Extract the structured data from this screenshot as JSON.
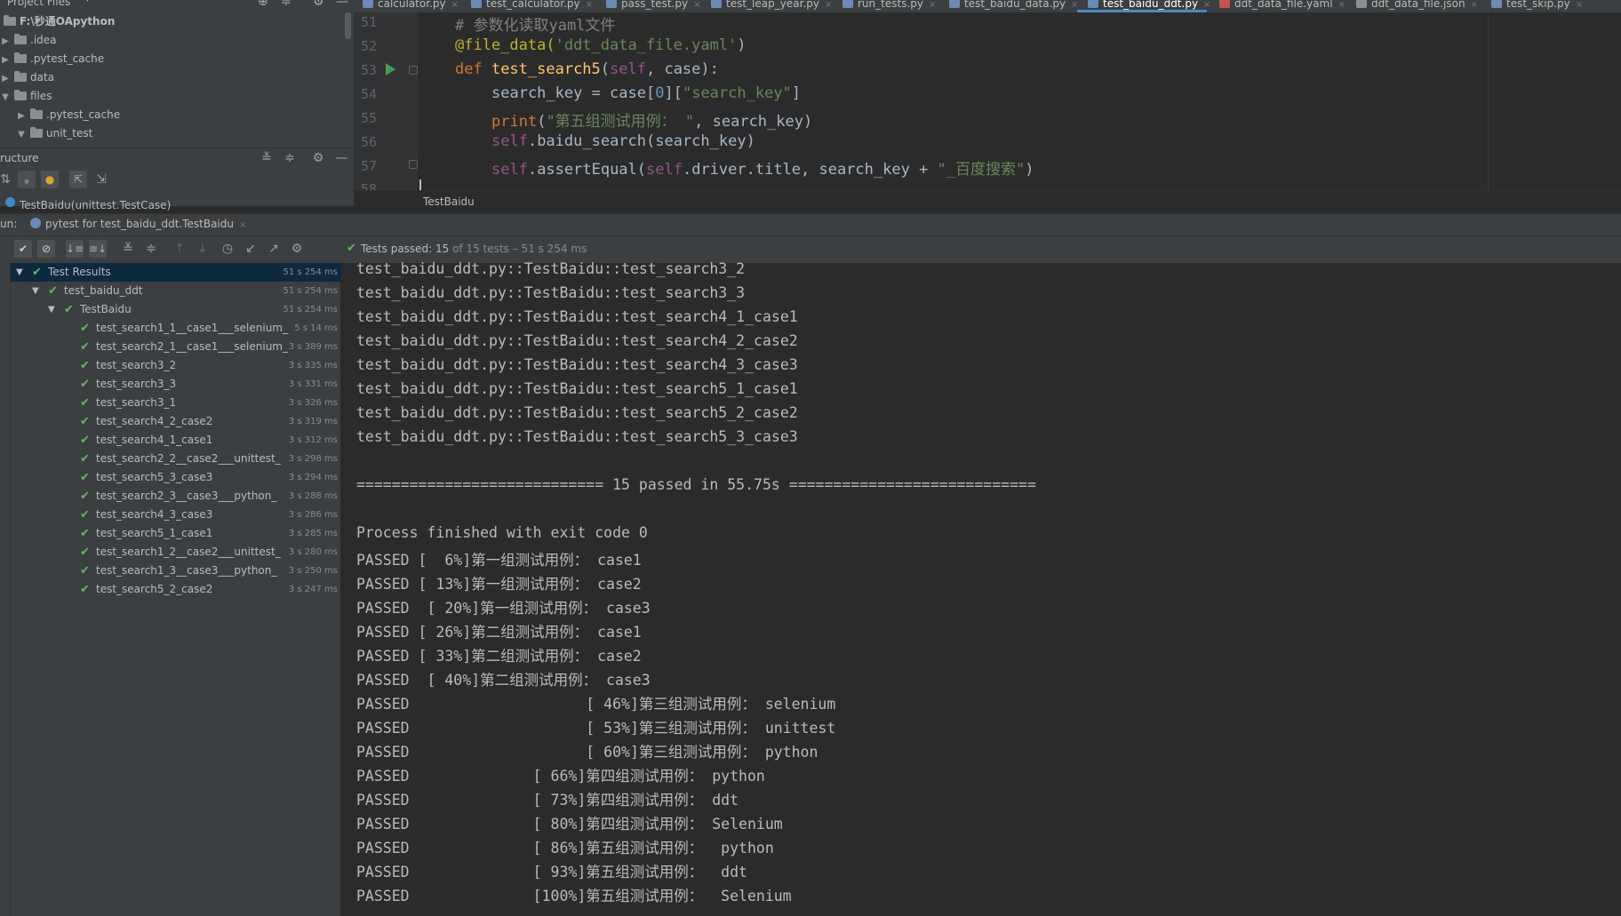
{
  "project": {
    "header": "Project Files",
    "root": "F:\\秒通OApython",
    "items": [
      ".idea",
      ".pytest_cache",
      "data",
      "files",
      ".pytest_cache",
      "unit_test"
    ]
  },
  "structure": {
    "title": "ructure",
    "item": "TestBaidu(unittest.TestCase)"
  },
  "editor": {
    "tabs": [
      "calculator.py",
      "test_calculator.py",
      "pass_test.py",
      "test_leap_year.py",
      "run_tests.py",
      "test_baidu_data.py",
      "test_baidu_ddt.py",
      "ddt_data_file.yaml",
      "ddt_data_file.json",
      "test_skip.py"
    ],
    "active_tab": "test_baidu_ddt.py",
    "line_numbers": [
      "51",
      "52",
      "53",
      "54",
      "55",
      "56",
      "57",
      "58"
    ],
    "breadcrumb": "TestBaidu"
  },
  "run": {
    "label": "un:",
    "tab": "pytest for test_baidu_ddt.TestBaidu",
    "status_passed": "Tests passed: 15",
    "status_of": "of 15 tests – 51 s 254 ms"
  },
  "tests": {
    "root": {
      "name": "Test Results",
      "time": "51 s 254 ms"
    },
    "module": {
      "name": "test_baidu_ddt",
      "time": "51 s 254 ms"
    },
    "class": {
      "name": "TestBaidu",
      "time": "51 s 254 ms"
    },
    "items": [
      {
        "name": "test_search1_1__case1___selenium_",
        "time": "5 s 14 ms"
      },
      {
        "name": "test_search2_1__case1___selenium_",
        "time": "3 s 389 ms"
      },
      {
        "name": "test_search3_2",
        "time": "3 s 335 ms"
      },
      {
        "name": "test_search3_3",
        "time": "3 s 331 ms"
      },
      {
        "name": "test_search3_1",
        "time": "3 s 326 ms"
      },
      {
        "name": "test_search4_2_case2",
        "time": "3 s 319 ms"
      },
      {
        "name": "test_search4_1_case1",
        "time": "3 s 312 ms"
      },
      {
        "name": "test_search2_2__case2___unittest_",
        "time": "3 s 298 ms"
      },
      {
        "name": "test_search5_3_case3",
        "time": "3 s 294 ms"
      },
      {
        "name": "test_search2_3__case3___python_",
        "time": "3 s 288 ms"
      },
      {
        "name": "test_search4_3_case3",
        "time": "3 s 286 ms"
      },
      {
        "name": "test_search5_1_case1",
        "time": "3 s 285 ms"
      },
      {
        "name": "test_search1_2__case2___unittest_",
        "time": "3 s 280 ms"
      },
      {
        "name": "test_search1_3__case3___python_",
        "time": "3 s 250 ms"
      },
      {
        "name": "test_search5_2_case2",
        "time": "3 s 247 ms"
      }
    ]
  },
  "console": {
    "lines": [
      "test_baidu_ddt.py::TestBaidu::test_search3_2",
      "test_baidu_ddt.py::TestBaidu::test_search3_3",
      "test_baidu_ddt.py::TestBaidu::test_search4_1_case1",
      "test_baidu_ddt.py::TestBaidu::test_search4_2_case2",
      "test_baidu_ddt.py::TestBaidu::test_search4_3_case3",
      "test_baidu_ddt.py::TestBaidu::test_search5_1_case1",
      "test_baidu_ddt.py::TestBaidu::test_search5_2_case2",
      "test_baidu_ddt.py::TestBaidu::test_search5_3_case3",
      "",
      "============================ 15 passed in 55.75s ============================",
      "",
      "Process finished with exit code 0",
      "PASSED [  6%]第一组测试用例： case1",
      "PASSED [ 13%]第一组测试用例： case2",
      "PASSED  [ 20%]第一组测试用例： case3",
      "PASSED [ 26%]第二组测试用例： case1",
      "PASSED [ 33%]第二组测试用例： case2",
      "PASSED  [ 40%]第二组测试用例： case3",
      "PASSED                    [ 46%]第三组测试用例： selenium",
      "PASSED                    [ 53%]第三组测试用例： unittest",
      "PASSED                    [ 60%]第三组测试用例： python",
      "PASSED              [ 66%]第四组测试用例： python",
      "PASSED              [ 73%]第四组测试用例： ddt",
      "PASSED              [ 80%]第四组测试用例： Selenium",
      "PASSED              [ 86%]第五组测试用例：  python",
      "PASSED              [ 93%]第五组测试用例：  ddt",
      "PASSED              [100%]第五组测试用例：  Selenium"
    ]
  },
  "code_tokens": {
    "l51": "# 参数化读取yaml文件",
    "l52_deco": "@file_data(",
    "l52_str": "'ddt_data_file.yaml'",
    "l52_end": ")",
    "l53_def": "def ",
    "l53_fn": "test_search5",
    "l53_open": "(",
    "l53_self": "self",
    "l53_rest": ", case):",
    "l54_a": "search_key = case[",
    "l54_num": "0",
    "l54_b": "][",
    "l54_str": "\"search_key\"",
    "l54_c": "]",
    "l55_fn": "print",
    "l55_a": "(",
    "l55_str": "\"第五组测试用例： \"",
    "l55_b": ", search_key)",
    "l56_self": "self",
    "l56_a": ".baidu_search(search_key)",
    "l57_self": "self",
    "l57_a": ".assertEqual(",
    "l57_self2": "self",
    "l57_b": ".driver.title, search_key + ",
    "l57_str": "\"_百度搜索\"",
    "l57_c": ")"
  },
  "colors": {
    "pass_green": "#5fb85f",
    "selection": "#0d293e",
    "accent": "#4a88c7"
  }
}
